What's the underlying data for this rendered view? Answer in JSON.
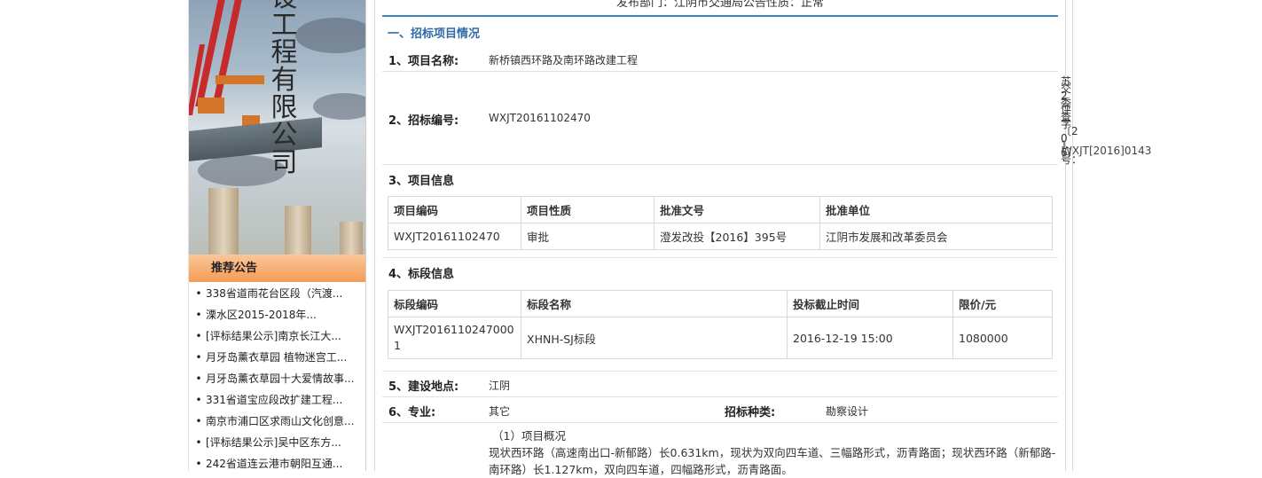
{
  "sidebar": {
    "banner_title": "设工程有限公司",
    "recommend_header": "推荐公告",
    "items": [
      "338省道雨花台区段（汽渡...",
      "溧水区2015-2018年...",
      "[评标结果公示]南京长江大...",
      "月牙岛薰衣草园 植物迷宫工...",
      "月牙岛薰衣草园十大爱情故事...",
      "331省道宝应段改扩建工程...",
      "南京市浦口区求雨山文化创意...",
      "[评标结果公示]吴中区东方...",
      "242省道连云港市朝阳互通..."
    ]
  },
  "main": {
    "top_text": "发布部门：江阴市交通局公告性质：正常",
    "section_title": "一、招标项目情况",
    "project_name_label": "1、项目名称:",
    "project_name": "新桥镇西环路及南环路改建工程",
    "bid_code_label": "2、招标编号:",
    "bid_code": "WXJT20161102470",
    "project_info_label": "3、项目信息",
    "project_table": {
      "headers": [
        "项目编码",
        "项目性质",
        "批准文号",
        "批准单位"
      ],
      "rows": [
        [
          "WXJT20161102470",
          "审批",
          "澄发改投【2016】395号",
          "江阴市发展和改革委员会"
        ]
      ]
    },
    "section_info_label": "4、标段信息",
    "section_table": {
      "headers": [
        "标段编码",
        "标段名称",
        "投标截止时间",
        "限价/元"
      ],
      "rows": [
        [
          "WXJT2016110247000\n1",
          "XHNH-SJ标段",
          "2016-12-19 15:00",
          "1080000"
        ]
      ]
    },
    "location_label": "5、建设地点:",
    "location": "江阴",
    "specialty_label": "6、专业:",
    "specialty": "其它",
    "bid_type_label": "招标种类:",
    "bid_type": "勘察设计",
    "overview_title": "（1）项目概况",
    "overview_text": "现状西环路（高速南出口-新郁路）长0.631km，现状为双向四车道、三幅路形式，沥青路面；现状西环路（新郁路-南环路）长1.127km，双向四车道，四幅路形式，沥青路面。"
  },
  "right": {
    "vertical_text": "苏交2委评查字〔2016〕号：",
    "code": "WXJT[2016]0143"
  }
}
